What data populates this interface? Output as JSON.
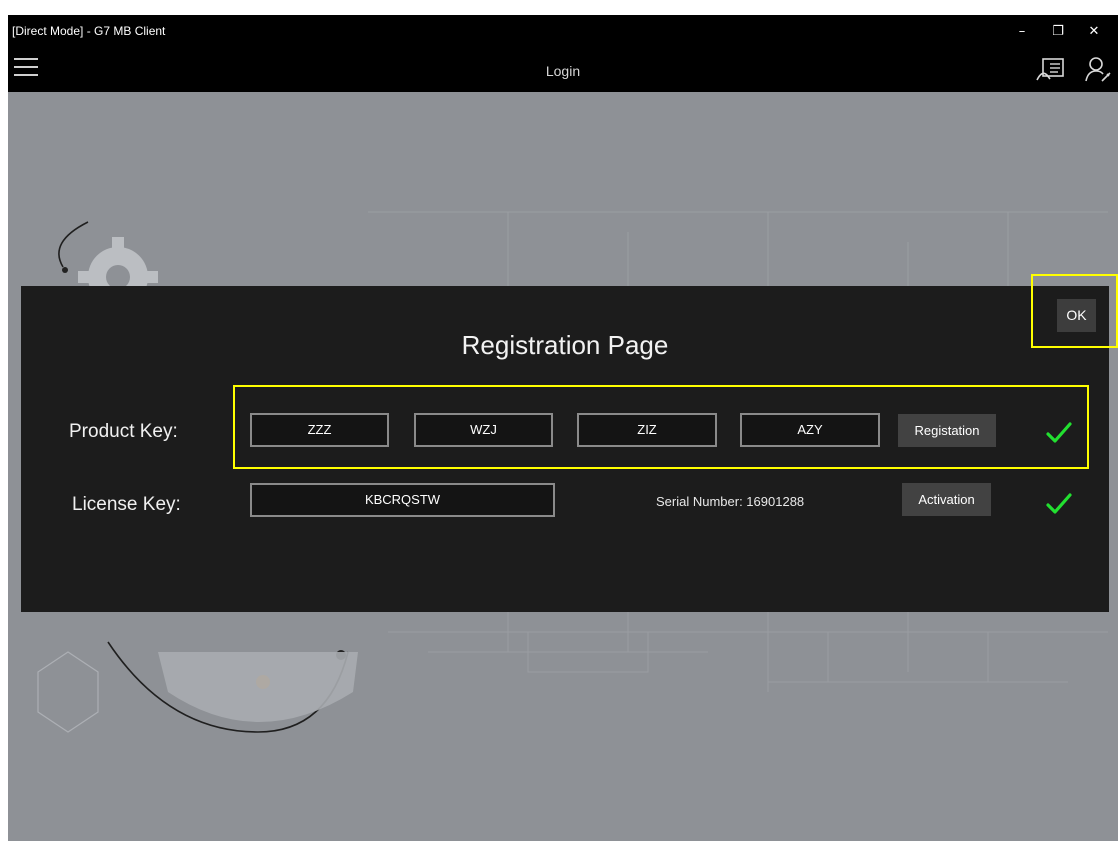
{
  "window": {
    "title": "[Direct Mode] - G7 MB Client"
  },
  "title_controls": {
    "minimize": "–",
    "restore": "❐",
    "close": "✕"
  },
  "appbar": {
    "title": "Login",
    "icons": [
      "menu-icon",
      "register-card-icon",
      "user-key-icon"
    ]
  },
  "dialog": {
    "title": "Registration Page",
    "ok_label": "OK",
    "product_key": {
      "label": "Product Key:",
      "segments": [
        "ZZZ",
        "WZJ",
        "ZIZ",
        "AZY"
      ],
      "button_label": "Registation",
      "status": "check-icon"
    },
    "license_key": {
      "label": "License Key:",
      "value": "KBCRQSTW",
      "serial_text": "Serial Number: 16901288",
      "button_label": "Activation",
      "status": "check-icon"
    }
  },
  "colors": {
    "accent_highlight": "#ffff00",
    "check_green": "#22e030",
    "panel_bg": "#1c1c1c",
    "titlebar_bg": "#000000"
  }
}
